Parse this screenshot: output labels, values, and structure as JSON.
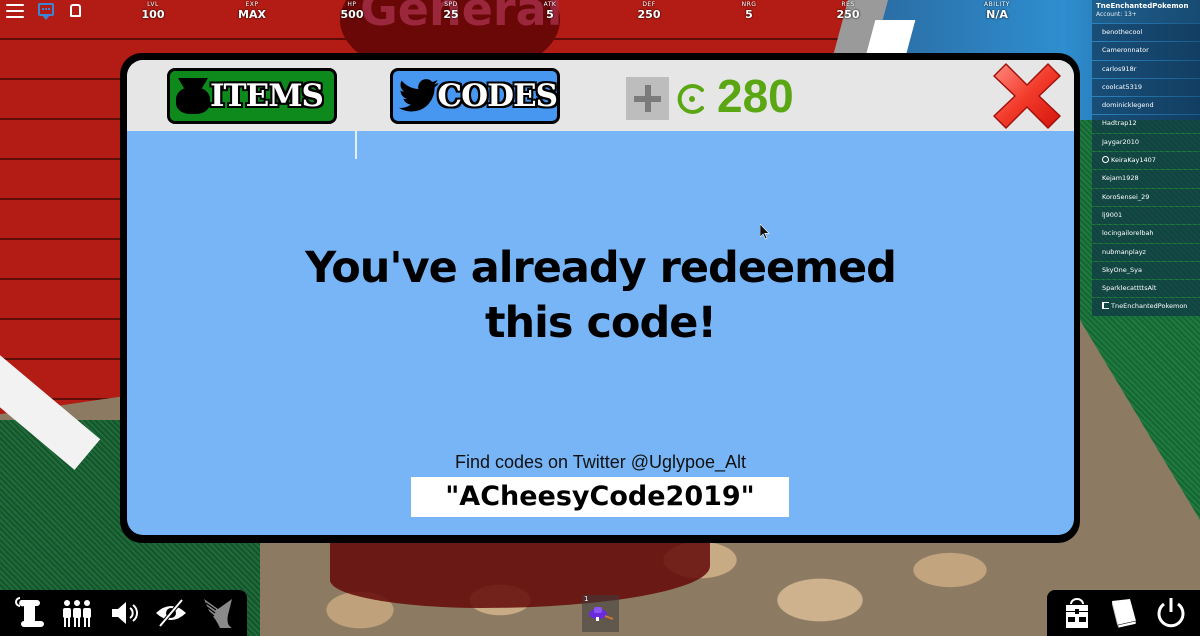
{
  "hud": {
    "stats": [
      {
        "label": "LVL",
        "value": "100"
      },
      {
        "label": "EXP",
        "value": "MAX"
      },
      {
        "label": "HP",
        "value": "500"
      },
      {
        "label": "SPD",
        "value": "25"
      },
      {
        "label": "ATK",
        "value": "5"
      },
      {
        "label": "DEF",
        "value": "250"
      },
      {
        "label": "NRG",
        "value": "5"
      },
      {
        "label": "RES",
        "value": "250"
      },
      {
        "label": "ABILITY",
        "value": "N/A"
      }
    ]
  },
  "background": {
    "sign_text": "General"
  },
  "player_list": {
    "local_player": "TneEnchantedPokemon",
    "account": "Account: 13+",
    "players": [
      {
        "name": "benothecool",
        "icon": ""
      },
      {
        "name": "Cameronnator",
        "icon": ""
      },
      {
        "name": "carlos918r",
        "icon": ""
      },
      {
        "name": "coolcat5319",
        "icon": ""
      },
      {
        "name": "dominicklegend",
        "icon": ""
      },
      {
        "name": "Hadtrap12",
        "icon": ""
      },
      {
        "name": "Jaygar2010",
        "icon": ""
      },
      {
        "name": "KeiraKay1407",
        "icon": "friend-icon"
      },
      {
        "name": "Kejam1928",
        "icon": ""
      },
      {
        "name": "KoroSensei_29",
        "icon": ""
      },
      {
        "name": "lj9001",
        "icon": ""
      },
      {
        "name": "locingailorelbah",
        "icon": ""
      },
      {
        "name": "nubmanplayz",
        "icon": ""
      },
      {
        "name": "SkyOne_Sya",
        "icon": ""
      },
      {
        "name": "SparklecattttsAlt",
        "icon": ""
      },
      {
        "name": "TneEnchantedPokemon",
        "icon": "self-icon"
      }
    ]
  },
  "modal": {
    "tabs": [
      {
        "label": "ITEMS",
        "icon": "pot-icon",
        "color": "#0e8a1c"
      },
      {
        "label": "CODES",
        "icon": "twitter-bird-icon",
        "color": "#4796f0"
      }
    ],
    "currency": {
      "amount": "280",
      "icon": "coin-icon",
      "color": "#5aa613"
    },
    "message_line1": "You've already redeemed",
    "message_line2": "this code!",
    "hint": "Find codes on Twitter @Uglypoe_Alt",
    "code_value": "\"ACheesyCode2019\"",
    "panel_color": "#77b5f7",
    "header_color": "#e6e6e6"
  },
  "hotbar": {
    "slots": [
      {
        "number": "1",
        "item": "hat-item"
      }
    ]
  },
  "bottom_left_buttons": [
    "scroll-icon",
    "party-icon",
    "volume-icon",
    "hide-eye-icon",
    "wing-icon"
  ],
  "bottom_right_buttons": [
    "backpack-icon",
    "book-icon",
    "power-icon"
  ]
}
